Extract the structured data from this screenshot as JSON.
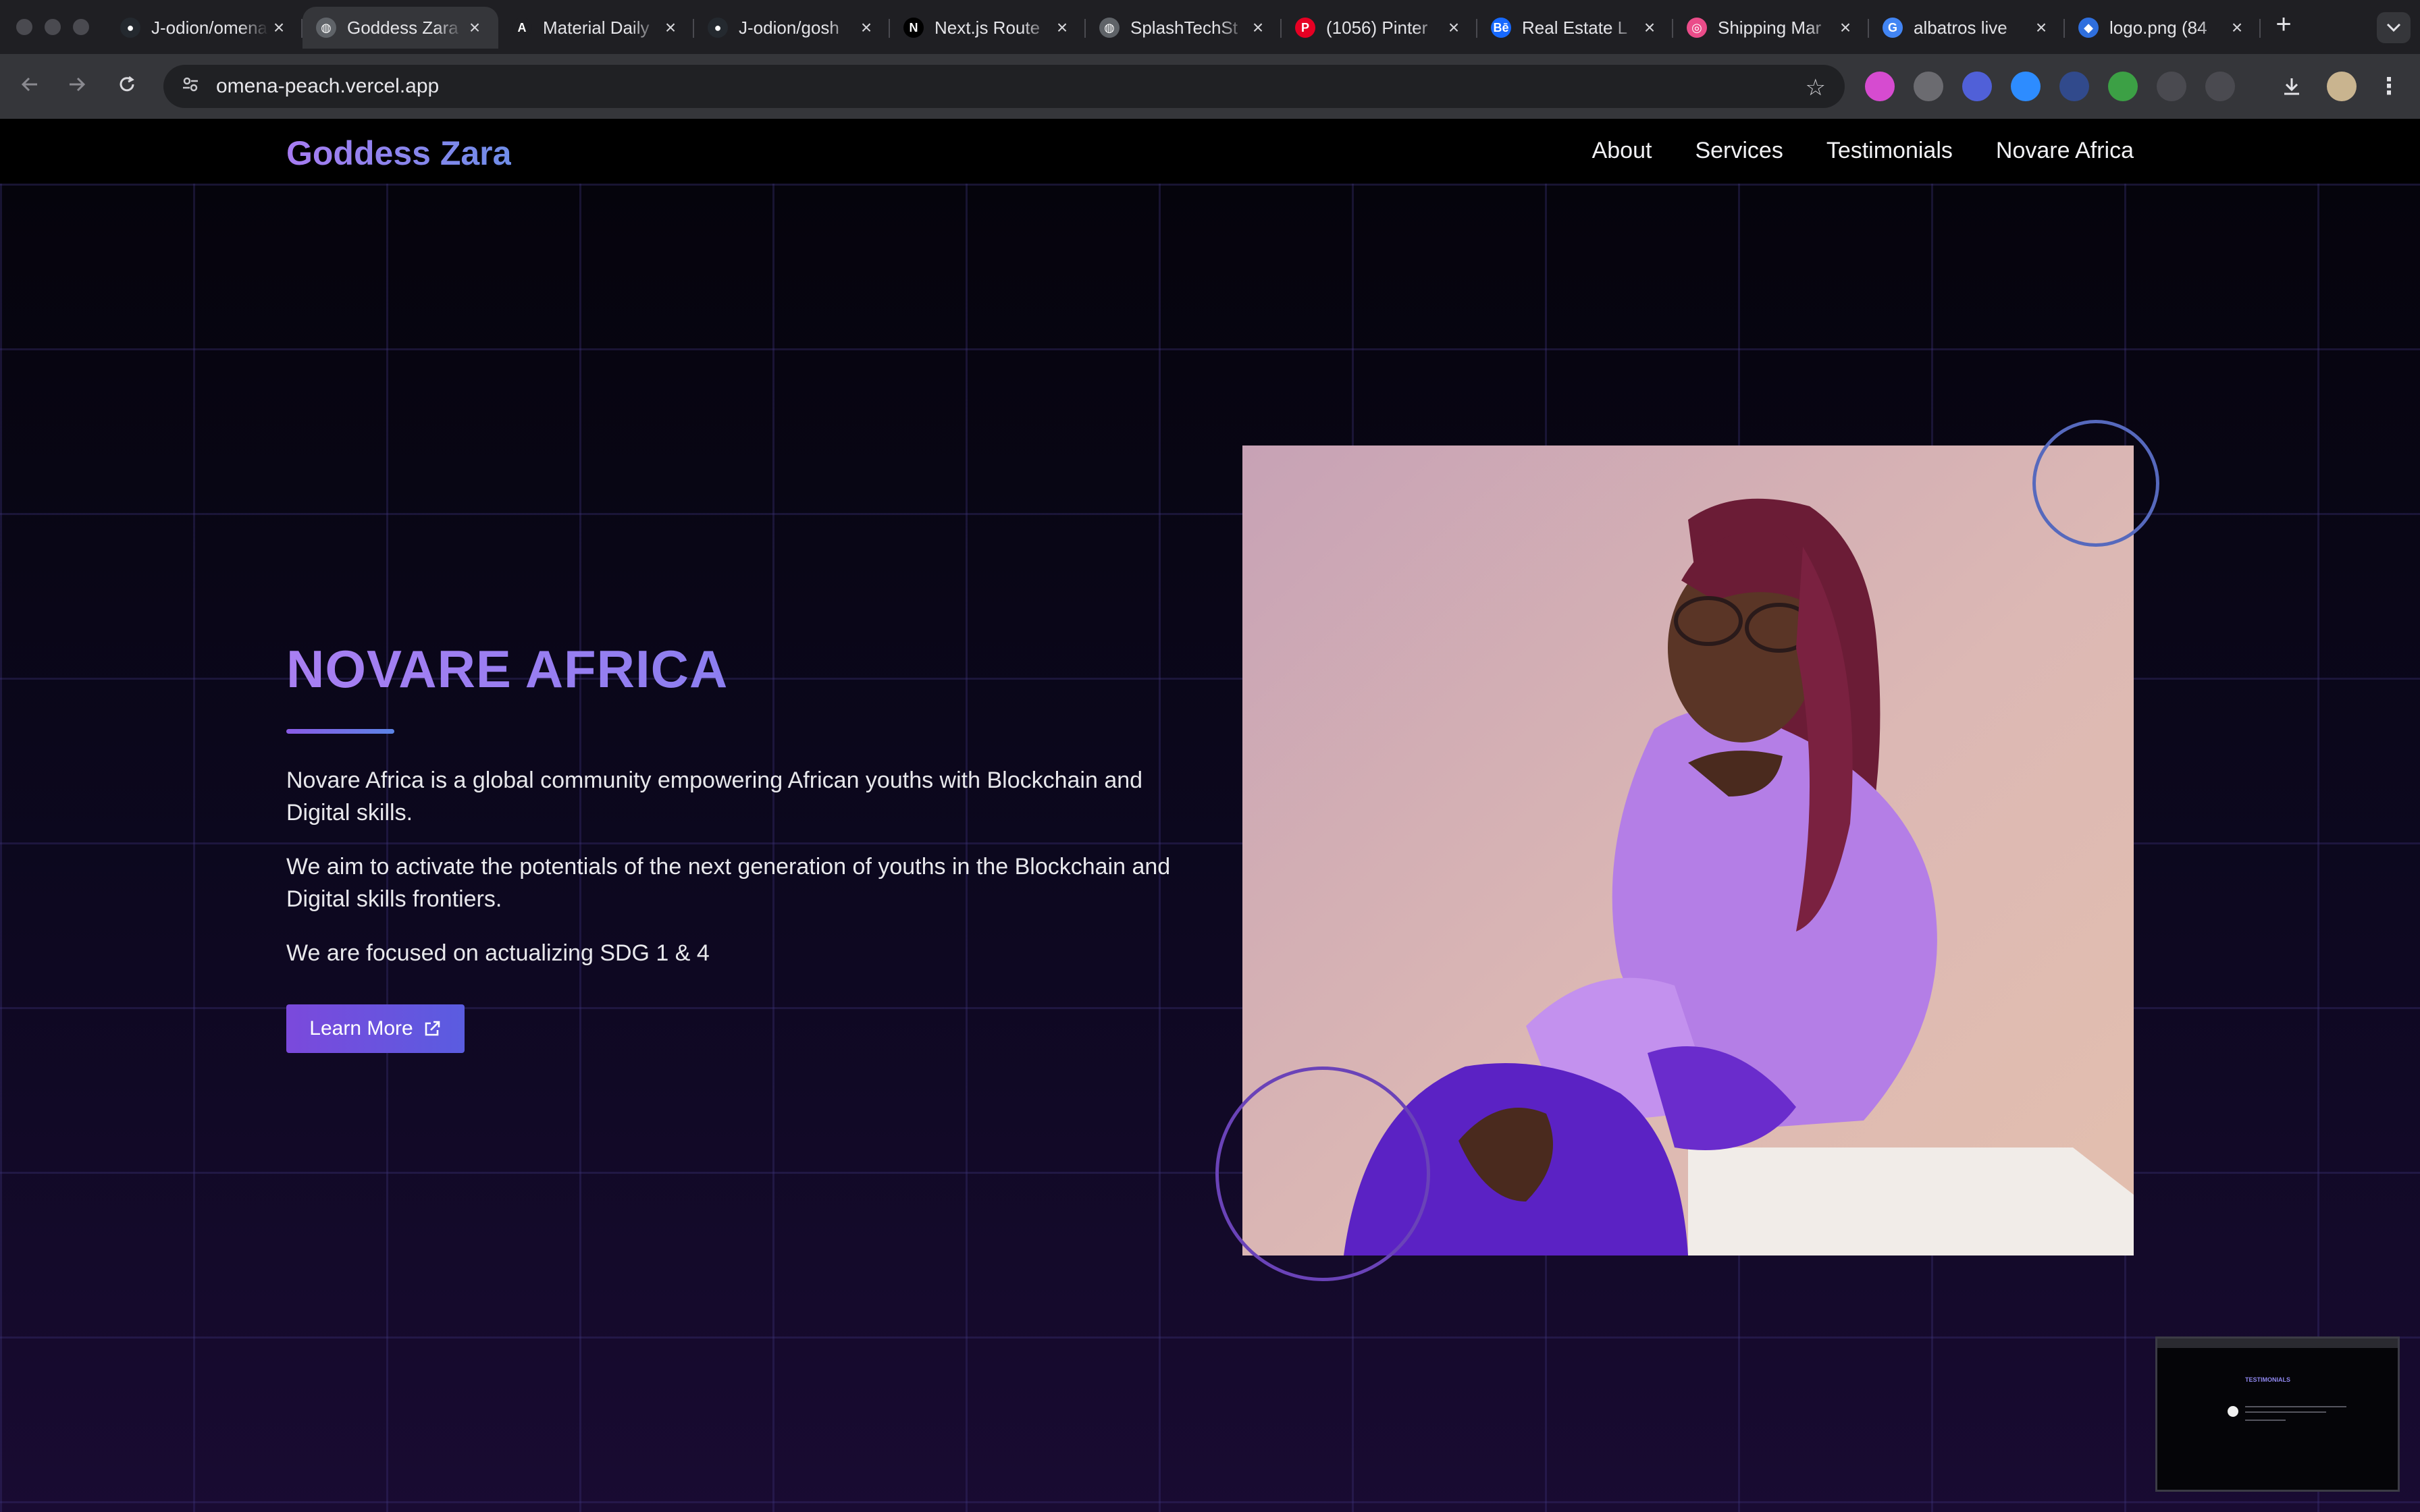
{
  "browser": {
    "tabs": [
      {
        "title": "J-odion/omena",
        "icon": "github-icon",
        "active": false,
        "color": "#24292f"
      },
      {
        "title": "Goddess Zara",
        "icon": "globe-icon",
        "active": true,
        "color": "#5f6368"
      },
      {
        "title": "Material Daily",
        "icon": "material-icon",
        "active": false,
        "color": "#1f1f23"
      },
      {
        "title": "J-odion/gosh",
        "icon": "github-icon",
        "active": false,
        "color": "#24292f"
      },
      {
        "title": "Next.js Route",
        "icon": "nextjs-icon",
        "active": false,
        "color": "#000000"
      },
      {
        "title": "SplashTechSt",
        "icon": "globe-icon",
        "active": false,
        "color": "#5f6368"
      },
      {
        "title": "(1056) Pinter",
        "icon": "pinterest-icon",
        "active": false,
        "color": "#e60023"
      },
      {
        "title": "Real Estate L",
        "icon": "behance-icon",
        "active": false,
        "color": "#1769ff"
      },
      {
        "title": "Shipping Mar",
        "icon": "dribbble-icon",
        "active": false,
        "color": "#ea4c89"
      },
      {
        "title": "albatros live",
        "icon": "google-icon",
        "active": false,
        "color": "#4285f4"
      },
      {
        "title": "logo.png (84",
        "icon": "drive-icon",
        "active": false,
        "color": "#2f6fde"
      }
    ],
    "new_tab_glyph": "+",
    "address_url": "omena-peach.vercel.app",
    "extensions": [
      {
        "name": "colorpick-extension-icon",
        "color": "#d64bd0"
      },
      {
        "name": "camera-extension-icon",
        "color": "#6b6b70"
      },
      {
        "name": "gear-extension-icon",
        "color": "#5060d8"
      },
      {
        "name": "zoom-extension-icon",
        "color": "#2d8cff"
      },
      {
        "name": "lt-extension-icon",
        "color": "#314a8c"
      },
      {
        "name": "green-extension-icon",
        "color": "#3ca045"
      },
      {
        "name": "eyedropper-extension-icon",
        "color": "#4a4a50"
      },
      {
        "name": "puzzle-extension-icon",
        "color": "#4a4a50"
      }
    ]
  },
  "site": {
    "brand": "Goddess Zara",
    "nav": [
      "About",
      "Services",
      "Testimonials",
      "Novare Africa"
    ],
    "title": "NOVARE AFRICA",
    "paragraphs": [
      "Novare Africa is a global community empowering African youths with Blockchain and Digital skills.",
      "We aim to activate the potentials of the next generation of youths in the Blockchain and Digital skills frontiers.",
      "We are focused on actualizing SDG 1 & 4"
    ],
    "button_label": "Learn More",
    "accent_purple": "#8a5be6",
    "accent_blue": "#5b84e6"
  },
  "preview": {
    "title": "TESTIMONIALS"
  }
}
